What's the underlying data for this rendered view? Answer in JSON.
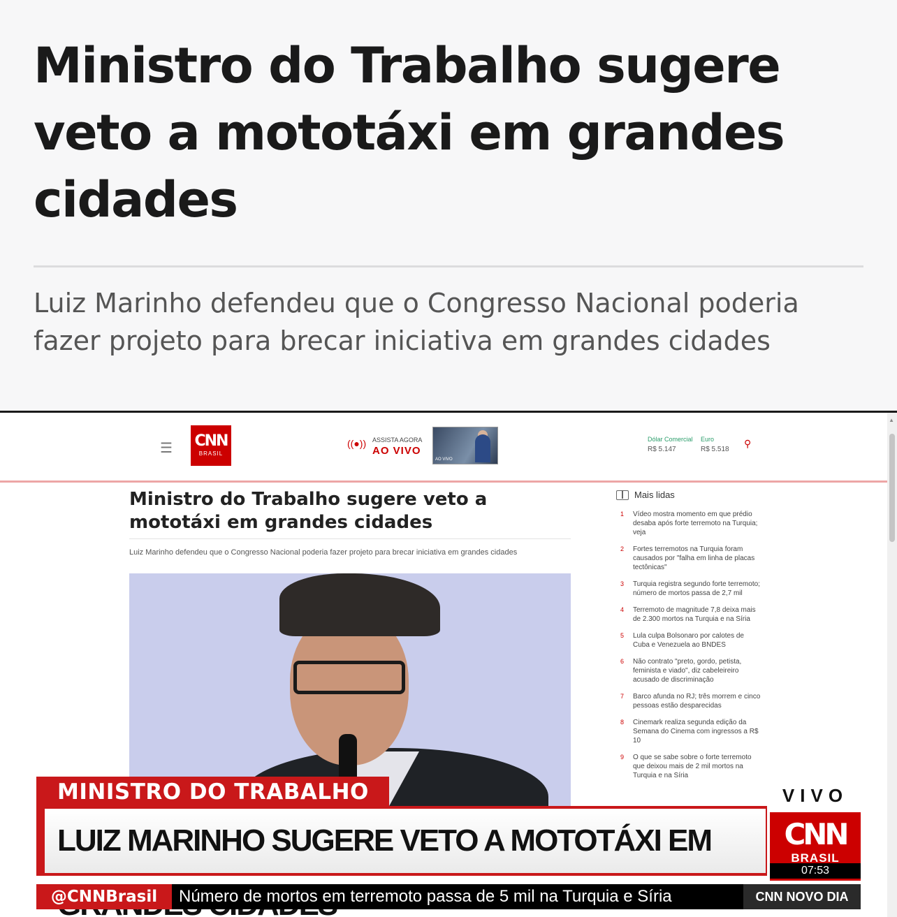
{
  "article": {
    "headline": "Ministro do Trabalho sugere veto a mototáxi em grandes cidades",
    "subtitle": "Luiz Marinho defendeu que o Congresso Nacional poderia fazer projeto para brecar iniciativa em grandes cidades"
  },
  "embedded_site": {
    "logo_main": "CNN",
    "logo_sub": "BRASIL",
    "live_label_small": "ASSISTA AGORA",
    "live_label_big": "AO VIVO",
    "live_thumb_tag": "AO VIVO",
    "currency": [
      {
        "label": "Dólar Comercial",
        "value": "R$ 5.147"
      },
      {
        "label": "Euro",
        "value": "R$ 5.518"
      }
    ],
    "title": "Ministro do Trabalho sugere veto a mototáxi em grandes cidades",
    "subtitle": "Luiz Marinho defendeu que o Congresso Nacional poderia fazer projeto para brecar iniciativa em grandes cidades",
    "mais_lidas": {
      "heading": "Mais lidas",
      "items": [
        {
          "n": "1",
          "text": "Vídeo mostra momento em que prédio desaba após forte terremoto na Turquia; veja"
        },
        {
          "n": "2",
          "text": "Fortes terremotos na Turquia foram causados por \"falha em linha de placas tectônicas\""
        },
        {
          "n": "3",
          "text": "Turquia registra segundo forte terremoto; número de mortos passa de 2,7 mil"
        },
        {
          "n": "4",
          "text": "Terremoto de magnitude 7,8 deixa mais de 2.300 mortos na Turquia e na Síria"
        },
        {
          "n": "5",
          "text": "Lula culpa Bolsonaro por calotes de Cuba e Venezuela ao BNDES"
        },
        {
          "n": "6",
          "text": "Não contrato \"preto, gordo, petista, feminista e viado\", diz cabeleireiro acusado de discriminação"
        },
        {
          "n": "7",
          "text": "Barco afunda no RJ; três morrem e cinco pessoas estão desparecidas"
        },
        {
          "n": "8",
          "text": "Cinemark realiza segunda edição da Semana do Cinema com ingressos a R$ 10"
        },
        {
          "n": "9",
          "text": "O que se sabe sobre o forte terremoto que deixou mais de 2 mil mortos na Turquia e na Síria"
        }
      ]
    }
  },
  "tv_overlay": {
    "topic": "MINISTRO DO TRABALHO",
    "headline": "LUIZ MARINHO SUGERE VETO A MOTOTÁXI EM GRANDES CIDADES",
    "vivo": "VIVO",
    "logo_main": "CNN",
    "logo_sub": "BRASIL",
    "time": "07:53",
    "ticker_handle": "@CNNBrasil",
    "ticker_text": "Número de mortos em terremoto passa de 5 mil na Turquia e Síria",
    "show_name": "CNN NOVO DIA"
  },
  "colors": {
    "cnn_red": "#cc0000",
    "overlay_red": "#c9181a",
    "fx_green": "#2a9d6a"
  }
}
